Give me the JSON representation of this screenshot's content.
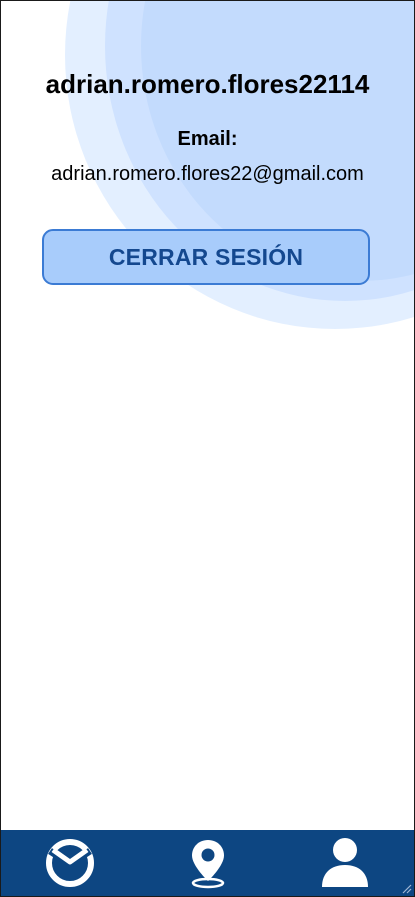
{
  "profile": {
    "username": "adrian.romero.flores22114",
    "email_label": "Email:",
    "email": "adrian.romero.flores22@gmail.com"
  },
  "actions": {
    "logout_label": "CERRAR SESIÓN"
  },
  "bottom_nav": {
    "items": [
      {
        "icon": "clock-icon"
      },
      {
        "icon": "location-pin-icon"
      },
      {
        "icon": "user-icon"
      }
    ]
  },
  "colors": {
    "nav_background": "#0d4682",
    "button_background": "#a8ccfb",
    "button_text": "#14488f",
    "accent_circle": "#c3dbfd"
  }
}
